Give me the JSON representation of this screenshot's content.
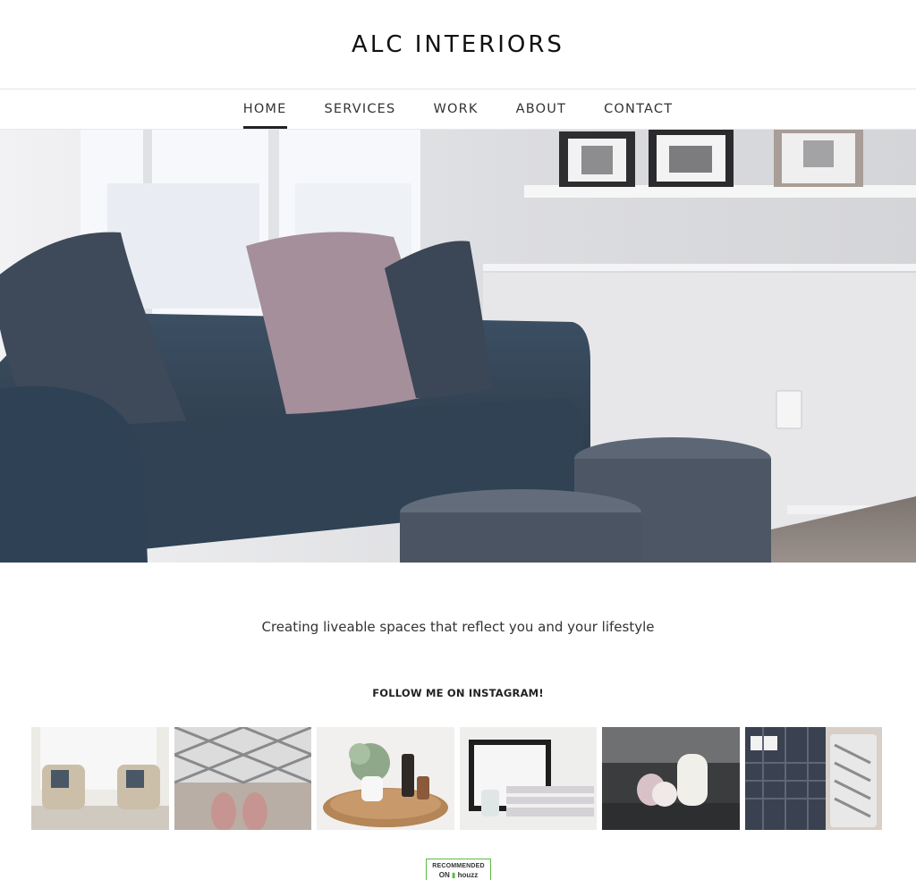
{
  "site": {
    "logo": "ALC INTERIORS"
  },
  "nav": {
    "items": [
      {
        "label": "HOME",
        "active": true
      },
      {
        "label": "SERVICES",
        "active": false
      },
      {
        "label": "WORK",
        "active": false
      },
      {
        "label": "ABOUT",
        "active": false
      },
      {
        "label": "CONTACT",
        "active": false
      }
    ]
  },
  "hero": {
    "image": "living-room-blue-sofa-photo"
  },
  "main": {
    "tagline": "Creating liveable spaces that reflect you and your lifestyle",
    "instagram_title": "FOLLOW ME ON INSTAGRAM!"
  },
  "instagram": {
    "tiles": [
      "armchairs-photo",
      "tile-floor-slippers-photo",
      "plant-tray-photo",
      "towels-shelf-photo",
      "vases-shelf-photo",
      "fabric-swatches-photo"
    ]
  },
  "badge": {
    "line1": "RECOMMENDED",
    "line2_prefix": "ON",
    "line2_brand": "houzz",
    "color": "#5dbb46"
  },
  "colors": {
    "accent": "#222222",
    "sofa": "#34475a"
  }
}
